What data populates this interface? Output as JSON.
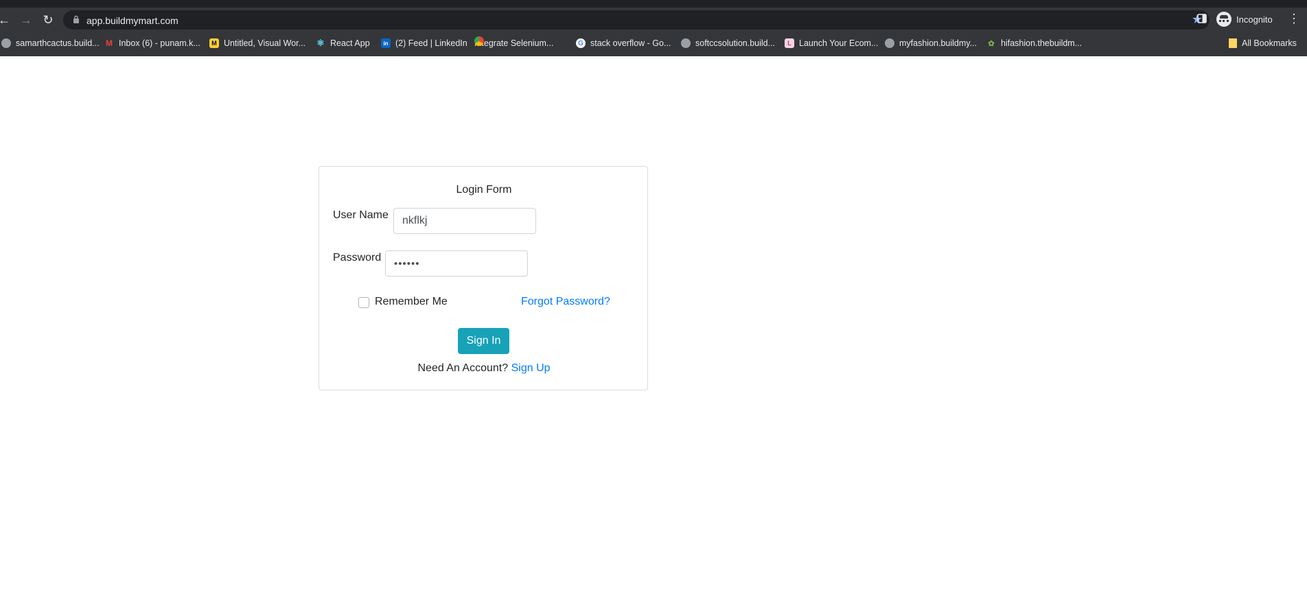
{
  "browser": {
    "url": "app.buildmymart.com",
    "profile_label": "Incognito",
    "bookmarks": [
      {
        "label": "samarthcactus.build...",
        "icon": "globe-icon"
      },
      {
        "label": "Inbox (6) - punam.k...",
        "icon": "gmail-icon"
      },
      {
        "label": "Untitled, Visual Wor...",
        "icon": "miro-icon"
      },
      {
        "label": "React App",
        "icon": "react-icon"
      },
      {
        "label": "(2) Feed | LinkedIn",
        "icon": "linkedin-icon"
      },
      {
        "label": "Integrate Selenium...",
        "icon": "chrome-icon"
      },
      {
        "label": "stack overflow - Go...",
        "icon": "google-icon"
      },
      {
        "label": "softccsolution.build...",
        "icon": "globe-icon"
      },
      {
        "label": "Launch Your Ecom...",
        "icon": "launch-icon"
      },
      {
        "label": "myfashion.buildmy...",
        "icon": "globe-icon"
      },
      {
        "label": "hifashion.thebuildm...",
        "icon": "leaf-icon"
      }
    ],
    "all_bookmarks_label": "All Bookmarks"
  },
  "login": {
    "title": "Login Form",
    "username_label": "User Name",
    "username_value": "nkflkj",
    "password_label": "Password",
    "password_value": "••••••",
    "remember_label": "Remember Me",
    "remember_checked": false,
    "forgot_label": "Forgot Password?",
    "signin_label": "Sign In",
    "need_account_text": "Need An Account?",
    "signup_label": "Sign Up"
  },
  "colors": {
    "chrome_bg": "#35363a",
    "omnibox_bg": "#202124",
    "primary_button": "#17a2b8",
    "link": "#007bff"
  }
}
